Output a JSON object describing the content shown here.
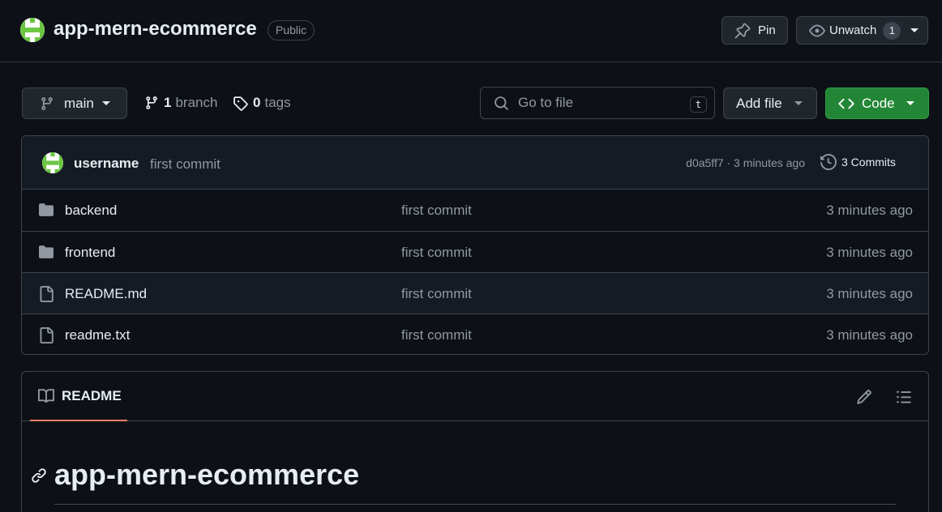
{
  "repo": {
    "name": "app-mern-ecommerce",
    "visibility": "Public"
  },
  "header_actions": {
    "pin_label": "Pin",
    "watch_label": "Unwatch",
    "watch_count": "1"
  },
  "toolbar": {
    "branch": "main",
    "branch_count": "1",
    "branch_label": "branch",
    "tag_count": "0",
    "tag_label": "tags",
    "search_placeholder": "Go to file",
    "search_shortcut": "t",
    "add_file_label": "Add file",
    "code_label": "Code"
  },
  "latest_commit": {
    "user": "username",
    "message": "first commit",
    "meta": "d0a5ff7 · 3 minutes ago",
    "commits_label": "3 Commits"
  },
  "files": [
    {
      "name": "backend",
      "type": "folder",
      "commit": "first commit",
      "time": "3 minutes ago"
    },
    {
      "name": "frontend",
      "type": "folder",
      "commit": "first commit",
      "time": "3 minutes ago"
    },
    {
      "name": "README.md",
      "type": "file",
      "commit": "first commit",
      "time": "3 minutes ago"
    },
    {
      "name": "readme.txt",
      "type": "file",
      "commit": "first commit",
      "time": "3 minutes ago"
    }
  ],
  "readme": {
    "tab_label": "README",
    "title": "app-mern-ecommerce"
  },
  "icons": {
    "avatar": "identicon-avatar",
    "pin": "pin-icon",
    "watch": "eye-icon",
    "branch": "git-branch-icon",
    "tag": "tag-icon",
    "search": "search-icon",
    "code": "code-icon",
    "history": "history-icon",
    "folder": "folder-icon",
    "file": "file-icon",
    "book": "book-icon",
    "edit": "pencil-icon",
    "outline": "list-icon",
    "anchor": "link-icon"
  },
  "colors": {
    "background": "#0d1117",
    "border": "#3d444d",
    "accent_green": "#238636",
    "tab_underline": "#f78166",
    "avatar_green": "#6cc644"
  }
}
